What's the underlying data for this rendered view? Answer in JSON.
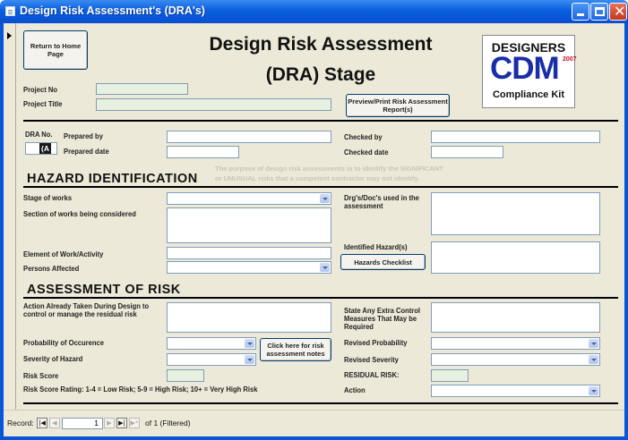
{
  "window": {
    "title": "Design Risk Assessment's (DRA's)"
  },
  "header": {
    "title_line1": "Design Risk Assessment",
    "title_line2": "(DRA) Stage",
    "return_button": "Return to Home Page",
    "project_no_label": "Project No",
    "project_title_label": "Project Title",
    "project_no_value": "",
    "project_title_value": "",
    "preview_button": "Preview/Print Risk Assessment Report(s)"
  },
  "logo": {
    "line1": "DESIGNERS",
    "line2": "CDM",
    "year": "2007",
    "line3": "Compliance Kit"
  },
  "dra": {
    "no_label": "DRA No.",
    "no_value": "(A",
    "prepared_by_label": "Prepared by",
    "prepared_date_label": "Prepared date",
    "checked_by_label": "Checked by",
    "checked_date_label": "Checked date"
  },
  "hazard": {
    "heading": "HAZARD IDENTIFICATION",
    "purpose_line1": "The purpose of design risk assessments is to identify the SIGNIFICANT",
    "purpose_line2": "or UNUSUAL risks that a competent contractor may not identify.",
    "stage_label": "Stage of works",
    "section_label": "Section of works being considered",
    "element_label": "Element of Work/Activity",
    "persons_label": "Persons Affected",
    "drgs_label": "Drg's/Doc's used in the assessment",
    "identified_label": "Identified Hazard(s)",
    "checklist_button": "Hazards Checklist"
  },
  "assessment": {
    "heading": "ASSESSMENT OF RISK",
    "action_taken_label": "Action Already Taken During Design to control or manage the residual risk",
    "probability_label": "Probability of Occurence",
    "severity_label": "Severity of Hazard",
    "risk_score_label": "Risk Score",
    "notes_button": "Click here for risk assessment notes",
    "rating_text": "Risk Score Rating: 1-4 = Low Risk; 5-9 = High Risk; 10+ = Very High Risk",
    "extra_label": "State Any Extra Control Measures That May be Required",
    "revised_prob_label": "Revised Probability",
    "revised_sev_label": "Revised Severity",
    "residual_label": "RESIDUAL RISK:",
    "action_label": "Action"
  },
  "navigation": {
    "record_label": "Record:",
    "current": "1",
    "of_text": "of 1 (Filtered)",
    "first": "|◀",
    "prev": "◀",
    "next": "▶",
    "last": "▶|",
    "new": "▶*"
  }
}
